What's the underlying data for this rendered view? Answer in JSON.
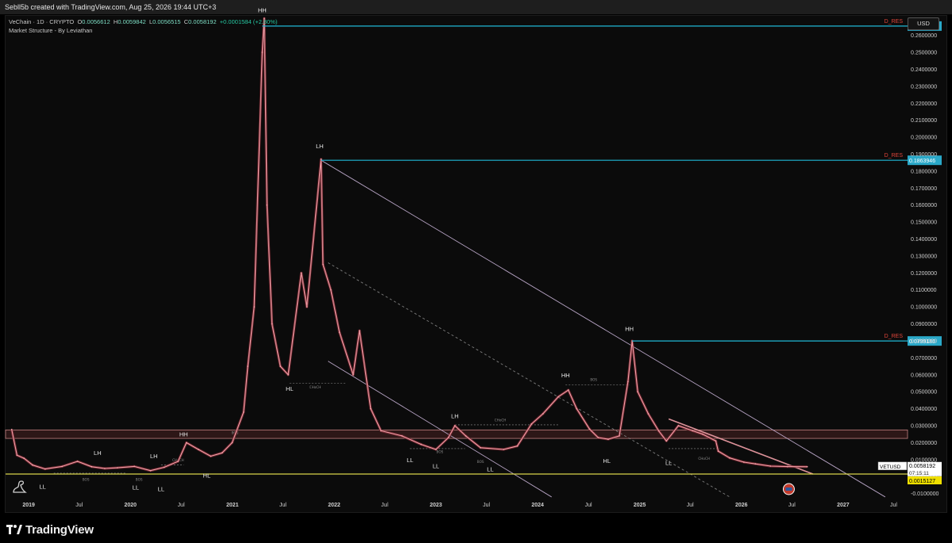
{
  "header": {
    "attribution": "Sebll5b created with TradingView.com, Aug 25, 2026 19:44 UTC+3"
  },
  "legend": {
    "symbol": "VeChain · 1D · CRYPTO",
    "open_label": "O",
    "open": "0.0056612",
    "high_label": "H",
    "high": "0.0059842",
    "low_label": "L",
    "low": "0.0056515",
    "close_label": "C",
    "close": "0.0058192",
    "change": "+0.0001584 (+2.80%)",
    "indicator": "Market Structure - By Leviathan"
  },
  "currency": "USD",
  "brand": {
    "name": "TradingView"
  },
  "colors": {
    "candle": "#f2a0a8",
    "level": "#1fb8d6",
    "trend": "#c9b4d8",
    "dashed": "#8a8a8a",
    "zone_fill": "#3a1c1c",
    "zone_edge": "#c28080",
    "support": "#d8d24a",
    "resistance_label": "#e0453a",
    "price_tag": "#ffffff",
    "low_tag": "#f0e000"
  },
  "chart_data": {
    "type": "line",
    "series": [
      {
        "x": [
          "2018-11-01",
          "2018-11-20",
          "2018-12-15",
          "2019-01-15",
          "2019-03-01",
          "2019-05-01",
          "2019-06-25",
          "2019-08-15",
          "2019-10-01",
          "2019-11-15",
          "2020-01-15",
          "2020-03-13",
          "2020-05-01",
          "2020-06-20",
          "2020-07-20",
          "2020-09-01",
          "2020-10-15",
          "2020-11-25",
          "2020-12-31",
          "2021-02-10",
          "2021-02-25",
          "2021-03-20",
          "2021-04-18",
          "2021-04-25",
          "2021-05-05",
          "2021-05-23",
          "2021-06-22",
          "2021-07-20",
          "2021-09-05",
          "2021-09-25",
          "2021-11-15",
          "2021-11-22",
          "2021-12-20",
          "2022-01-20",
          "2022-03-10",
          "2022-04-02",
          "2022-05-12",
          "2022-06-18",
          "2022-09-01",
          "2022-11-09",
          "2023-01-01",
          "2023-02-15",
          "2023-03-10",
          "2023-04-18",
          "2023-06-10",
          "2023-09-01",
          "2023-10-20",
          "2023-12-10",
          "2024-01-20",
          "2024-03-15",
          "2024-04-20",
          "2024-05-20",
          "2024-07-05",
          "2024-08-05",
          "2024-09-10",
          "2024-10-20",
          "2024-11-20",
          "2024-12-05",
          "2024-12-25",
          "2025-02-01",
          "2025-03-10",
          "2025-04-07",
          "2025-05-20",
          "2025-07-10",
          "2025-08-15",
          "2025-10-01",
          "2025-10-10",
          "2025-11-20",
          "2026-01-10",
          "2026-02-20",
          "2026-04-15",
          "2026-06-15",
          "2026-08-25"
        ],
        "y": [
          0.0278,
          0.0126,
          0.0108,
          0.0068,
          0.0045,
          0.006,
          0.009,
          0.0058,
          0.0048,
          0.0052,
          0.006,
          0.0035,
          0.0055,
          0.009,
          0.02,
          0.016,
          0.012,
          0.014,
          0.02,
          0.038,
          0.065,
          0.1,
          0.25,
          0.27,
          0.16,
          0.09,
          0.065,
          0.06,
          0.12,
          0.1,
          0.187,
          0.125,
          0.11,
          0.085,
          0.06,
          0.086,
          0.04,
          0.027,
          0.024,
          0.019,
          0.016,
          0.023,
          0.03,
          0.024,
          0.017,
          0.016,
          0.018,
          0.031,
          0.037,
          0.047,
          0.051,
          0.04,
          0.028,
          0.023,
          0.022,
          0.024,
          0.056,
          0.08,
          0.05,
          0.037,
          0.027,
          0.021,
          0.03,
          0.027,
          0.025,
          0.021,
          0.015,
          0.011,
          0.0085,
          0.0075,
          0.0062,
          0.0059,
          0.0058192
        ]
      }
    ],
    "xlabel": "",
    "ylabel": "",
    "xlim": [
      "2018-10-10",
      "2027-08-20"
    ],
    "ylim": [
      -0.0125,
      0.2715
    ],
    "x_ticks": [
      {
        "label": "2019",
        "date": "2019-01-01",
        "bold": true
      },
      {
        "label": "Jul",
        "date": "2019-07-01"
      },
      {
        "label": "2020",
        "date": "2020-01-01",
        "bold": true
      },
      {
        "label": "Jul",
        "date": "2020-07-01"
      },
      {
        "label": "2021",
        "date": "2021-01-01",
        "bold": true
      },
      {
        "label": "Jul",
        "date": "2021-07-01"
      },
      {
        "label": "2022",
        "date": "2022-01-01",
        "bold": true
      },
      {
        "label": "Jul",
        "date": "2022-07-01"
      },
      {
        "label": "2023",
        "date": "2023-01-01",
        "bold": true
      },
      {
        "label": "Jul",
        "date": "2023-07-01"
      },
      {
        "label": "2024",
        "date": "2024-01-01",
        "bold": true
      },
      {
        "label": "Jul",
        "date": "2024-07-01"
      },
      {
        "label": "2025",
        "date": "2025-01-01",
        "bold": true
      },
      {
        "label": "Jul",
        "date": "2025-07-01"
      },
      {
        "label": "2026",
        "date": "2026-01-01",
        "bold": true
      },
      {
        "label": "Jul",
        "date": "2026-07-01"
      },
      {
        "label": "2027",
        "date": "2027-01-01",
        "bold": true
      },
      {
        "label": "Jul",
        "date": "2027-07-01"
      }
    ],
    "y_ticks": [
      0.26,
      0.25,
      0.24,
      0.23,
      0.22,
      0.21,
      0.2,
      0.19,
      0.18,
      0.17,
      0.16,
      0.15,
      0.14,
      0.13,
      0.12,
      0.11,
      0.1,
      0.09,
      0.08,
      0.07,
      0.06,
      0.05,
      0.04,
      0.03,
      0.02,
      0.01,
      0.0,
      -0.01
    ],
    "y_tick_labels": [
      "0.2600000",
      "0.2500000",
      "0.2400000",
      "0.2300000",
      "0.2200000",
      "0.2100000",
      "0.2000000",
      "0.1900000",
      "0.1800000",
      "0.1700000",
      "0.1600000",
      "0.1500000",
      "0.1400000",
      "0.1300000",
      "0.1200000",
      "0.1100000",
      "0.1000000",
      "0.0900000",
      "0.0800000",
      "0.0700000",
      "0.0600000",
      "0.0500000",
      "0.0400000",
      "0.0300000",
      "0.0200000",
      "0.0100000",
      "0.0000000",
      "-0.0100000"
    ],
    "grid": false,
    "resistance_levels": [
      {
        "label": "D_RES",
        "value": 0.2655,
        "start": "2021-04-18",
        "price_label": "0.2655000"
      },
      {
        "label": "D_RES",
        "value": 0.1863946,
        "start": "2021-11-15",
        "price_label": "0.1863946"
      },
      {
        "label": "D_RES",
        "value": 0.079918,
        "start": "2024-12-05",
        "price_label": "0.0799180"
      }
    ],
    "support": {
      "value": 0.0015127,
      "start": "2018-10-10",
      "price_label": "0.0015127"
    },
    "zone": {
      "y0": 0.0225,
      "y1": 0.0275,
      "start": "2018-10-10",
      "end": "2027-08-20"
    },
    "last_price": {
      "symbol": "VETUSD",
      "value": 0.0058192,
      "price_label": "0.0058192",
      "countdown": "07:15:11"
    },
    "trendlines": [
      {
        "style": "solid",
        "color": "trend",
        "x1": "2021-11-15",
        "y1": 0.1863946,
        "x2": "2027-06-01",
        "y2": -0.012
      },
      {
        "style": "solid",
        "color": "trend",
        "x1": "2021-12-10",
        "y1": 0.068,
        "x2": "2024-02-20",
        "y2": -0.012
      },
      {
        "style": "solid",
        "color": "candle",
        "x1": "2025-04-15",
        "y1": 0.034,
        "x2": "2026-09-15",
        "y2": 0.0015
      },
      {
        "style": "dashed",
        "color": "dashed",
        "x1": "2021-12-10",
        "y1": 0.126,
        "x2": "2025-11-20",
        "y2": -0.012
      }
    ],
    "markers": [
      {
        "text": "HH",
        "x": "2021-04-18",
        "y": 0.2735,
        "dy": 0
      },
      {
        "text": "LH",
        "x": "2021-11-10",
        "y": 0.1935,
        "dy": 0
      },
      {
        "text": "HH",
        "x": "2024-11-25",
        "y": 0.0858,
        "dy": 0
      },
      {
        "text": "HH",
        "x": "2024-04-10",
        "y": 0.0585,
        "dy": 0
      },
      {
        "text": "LH",
        "x": "2023-03-10",
        "y": 0.0345,
        "dy": 0
      },
      {
        "text": "HH",
        "x": "2020-07-10",
        "y": 0.0238,
        "dy": 0
      },
      {
        "text": "LH",
        "x": "2019-09-05",
        "y": 0.0128,
        "dy": 0
      },
      {
        "text": "LH",
        "x": "2020-03-25",
        "y": 0.0108,
        "dy": 0
      },
      {
        "text": "HL",
        "x": "2021-07-25",
        "y": 0.0505,
        "dy": 0
      },
      {
        "text": "HL",
        "x": "2020-10-01",
        "y": -0.0005,
        "dy": 0
      },
      {
        "text": "HL",
        "x": "2024-09-05",
        "y": 0.008,
        "dy": 0
      },
      {
        "text": "LL",
        "x": "2019-02-20",
        "y": -0.0072,
        "dy": 0
      },
      {
        "text": "LL",
        "x": "2020-01-20",
        "y": -0.0075,
        "dy": 0
      },
      {
        "text": "LL",
        "x": "2020-04-20",
        "y": -0.0085,
        "dy": 0
      },
      {
        "text": "LL",
        "x": "2022-09-30",
        "y": 0.0085,
        "dy": 0
      },
      {
        "text": "LL",
        "x": "2023-01-01",
        "y": 0.005,
        "dy": 0
      },
      {
        "text": "LL",
        "x": "2023-07-15",
        "y": 0.0032,
        "dy": 0
      },
      {
        "text": "LL",
        "x": "2025-04-15",
        "y": 0.0068,
        "dy": 0
      }
    ],
    "small_labels": [
      {
        "text": "BOS",
        "x": "2019-07-25",
        "y": -0.0025
      },
      {
        "text": "BOS",
        "x": "2020-02-01",
        "y": -0.0025
      },
      {
        "text": "CHoCH",
        "x": "2020-06-20",
        "y": 0.009
      },
      {
        "text": "BOS",
        "x": "2021-01-10",
        "y": 0.025
      },
      {
        "text": "CHoCH",
        "x": "2021-10-25",
        "y": 0.052
      },
      {
        "text": "BOS",
        "x": "2023-01-15",
        "y": 0.014
      },
      {
        "text": "BOS",
        "x": "2023-06-10",
        "y": 0.008
      },
      {
        "text": "CHoCH",
        "x": "2023-08-20",
        "y": 0.0325
      },
      {
        "text": "BOS",
        "x": "2024-07-20",
        "y": 0.0565
      },
      {
        "text": "CHoCH",
        "x": "2025-08-20",
        "y": 0.01
      }
    ],
    "structure_lines": [
      {
        "x1": "2019-04-01",
        "x2": "2019-12-15",
        "y": 0.002
      },
      {
        "x1": "2020-04-20",
        "x2": "2020-07-10",
        "y": 0.0068
      },
      {
        "x1": "2021-07-25",
        "x2": "2022-02-15",
        "y": 0.055
      },
      {
        "x1": "2022-09-30",
        "x2": "2023-04-15",
        "y": 0.0165
      },
      {
        "x1": "2023-03-10",
        "x2": "2024-03-15",
        "y": 0.0305
      },
      {
        "x1": "2024-04-10",
        "x2": "2024-11-25",
        "y": 0.054
      },
      {
        "x1": "2025-04-15",
        "x2": "2025-10-15",
        "y": 0.0165
      }
    ]
  }
}
